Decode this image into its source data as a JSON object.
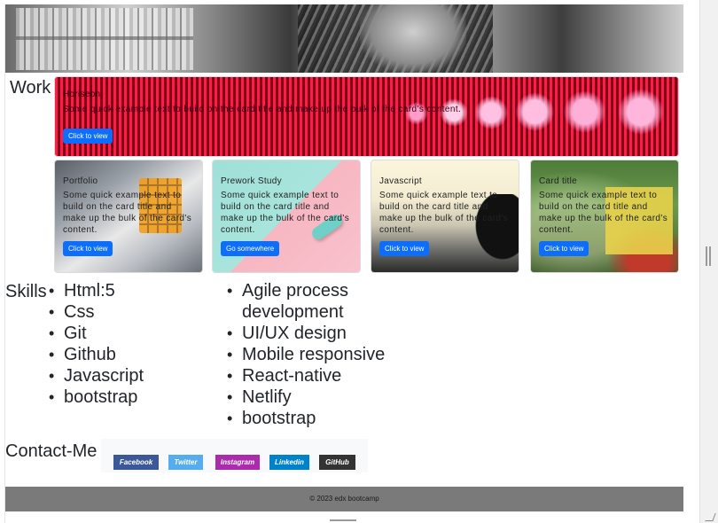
{
  "header": {
    "image": "hero-photo"
  },
  "sections": {
    "work": "Work",
    "skills": "Skills",
    "contact": "Contact-Me"
  },
  "work": {
    "featured": {
      "title": "Horiseon",
      "text": "Some quick example text to build on the card title and make up the bulk of the card's content.",
      "button": "Click to view"
    },
    "cards": [
      {
        "title": "Portfolio",
        "text": "Some quick example text to build on the card title and make up the bulk of the card's content.",
        "button": "Click to view"
      },
      {
        "title": "Prework Study",
        "text": "Some quick example text to build on the card title and make up the bulk of the card's content.",
        "button": "Go somewhere"
      },
      {
        "title": "Javascript",
        "text": "Some quick example text to build on the card title and make up the bulk of the card's content.",
        "button": "Click to view"
      },
      {
        "title": "Card title",
        "text": "Some quick example text to build on the card title and make up the bulk of the card's content.",
        "button": "Click to view"
      }
    ]
  },
  "skills": {
    "list1": [
      "Html:5",
      "Css",
      "Git",
      "Github",
      "Javascript",
      "bootstrap"
    ],
    "list2": [
      "Agile process development",
      "UI/UX design",
      "Mobile responsive",
      "React-native",
      "Netlify",
      "bootstrap"
    ]
  },
  "contact": {
    "buttons": [
      "Facebook",
      "Twitter",
      "Instagram",
      "Linkedin",
      "GitHub"
    ]
  },
  "footer": {
    "text": "© 2023 edx bootcamp"
  },
  "colors": {
    "primary_button": "#0d6efd",
    "facebook": "#3b5998",
    "twitter": "#55acee",
    "instagram": "#ac2bac",
    "linkedin": "#0082ca",
    "github": "#333333",
    "footer_bg": "#7a7a7a"
  }
}
